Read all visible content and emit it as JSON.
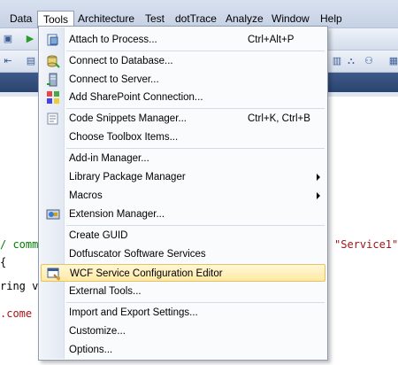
{
  "menubar": {
    "items": [
      "Data",
      "Tools",
      "Architecture",
      "Test",
      "dotTrace",
      "Analyze",
      "Window",
      "Help"
    ]
  },
  "code": {
    "lines": [
      {
        "a": "/ comma",
        "b": "",
        "c": ""
      },
      {
        "a": "",
        "b": "",
        "c": "\"Service1\""
      },
      {
        "a": "",
        "b": "ring va",
        "c": ""
      },
      {
        "a": ".come {",
        "b": "",
        "c": ""
      }
    ]
  },
  "tools_menu": {
    "items": [
      {
        "label": "Attach to Process...",
        "shortcut": "Ctrl+Alt+P",
        "icon": "attach-process-icon"
      },
      {
        "label": "Connect to Database...",
        "shortcut": "",
        "icon": "database-connect-icon"
      },
      {
        "label": "Connect to Server...",
        "shortcut": "",
        "icon": "server-connect-icon"
      },
      {
        "label": "Add SharePoint Connection...",
        "shortcut": "",
        "icon": "sharepoint-icon"
      },
      {
        "label": "Code Snippets Manager...",
        "shortcut": "Ctrl+K, Ctrl+B",
        "icon": ""
      },
      {
        "label": "Choose Toolbox Items...",
        "shortcut": "",
        "icon": ""
      },
      {
        "label": "Add-in Manager...",
        "shortcut": "",
        "icon": ""
      },
      {
        "label": "Library Package Manager",
        "shortcut": "",
        "icon": "",
        "submenu": true
      },
      {
        "label": "Macros",
        "shortcut": "",
        "icon": "",
        "submenu": true
      },
      {
        "label": "Extension Manager...",
        "shortcut": "",
        "icon": "extension-manager-icon"
      },
      {
        "label": "Create GUID",
        "shortcut": "",
        "icon": ""
      },
      {
        "label": "Dotfuscator Software Services",
        "shortcut": "",
        "icon": ""
      },
      {
        "label": "WCF Service Configuration Editor",
        "shortcut": "",
        "icon": "wcf-editor-icon",
        "highlighted": true
      },
      {
        "label": "External Tools...",
        "shortcut": "",
        "icon": ""
      },
      {
        "label": "Import and Export Settings...",
        "shortcut": "",
        "icon": ""
      },
      {
        "label": "Customize...",
        "shortcut": "",
        "icon": ""
      },
      {
        "label": "Options...",
        "shortcut": "",
        "icon": ""
      }
    ]
  },
  "colors": {
    "highlight": "#ffe9a4",
    "tabstrip": "#2b446e",
    "code_string": "#a31515",
    "code_comment": "#008000",
    "code_keyword": "#0000ff"
  }
}
